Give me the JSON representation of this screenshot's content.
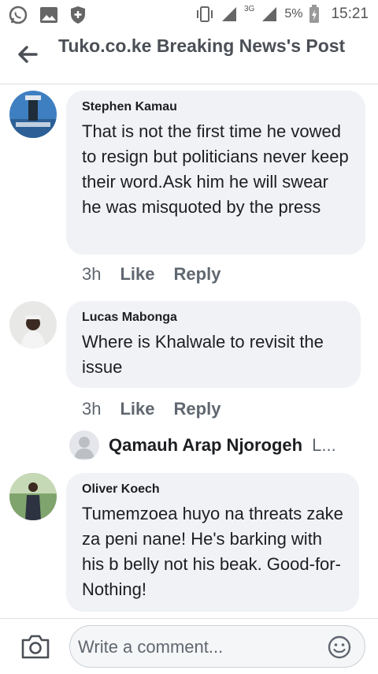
{
  "status": {
    "battery": "5%",
    "time": "15:21",
    "network": "3G"
  },
  "header": {
    "title": "Tuko.co.ke Breaking News's Post"
  },
  "comments": [
    {
      "author": "Stephen Kamau",
      "text": "That is not the first time he vowed to resign but politicians never keep their word.Ask him he will swear he was misquoted by the press",
      "time": "3h",
      "like": "Like",
      "reply": "Reply"
    },
    {
      "author": "Lucas Mabonga",
      "text": "Where is Khalwale to revisit the issue",
      "time": "3h",
      "like": "Like",
      "reply": "Reply"
    },
    {
      "author": "Oliver Koech",
      "text": "Tumemzoea huyo na threats zake za peni nane! He's barking with his b belly not his beak. Good-for-Nothing!"
    }
  ],
  "reply_preview": {
    "name": "Qamauh Arap Njorogeh",
    "trunc": "L..."
  },
  "composer": {
    "placeholder": "Write a comment..."
  }
}
